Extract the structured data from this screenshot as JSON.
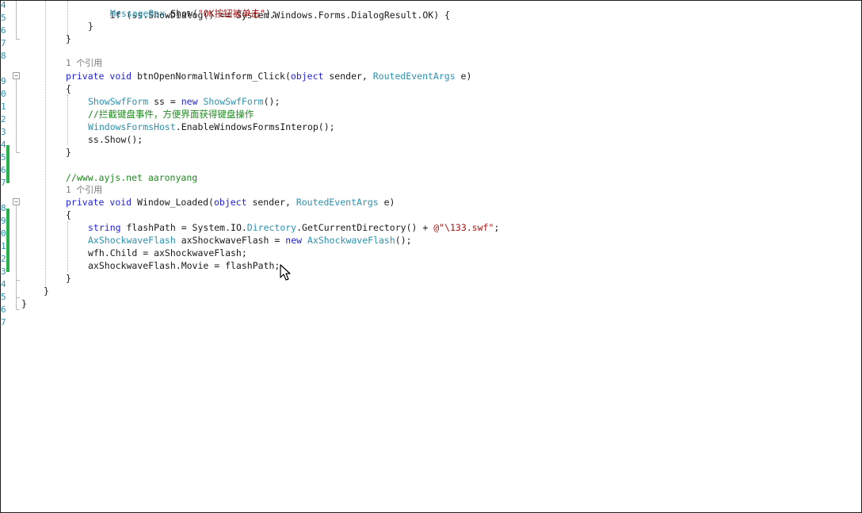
{
  "editor": {
    "line_numbers": [
      "4",
      "5",
      "6",
      "7",
      "8",
      "",
      "9",
      "0",
      "1",
      "2",
      "3",
      "4",
      "5",
      "6",
      "7",
      "",
      "8",
      "9",
      "0",
      "1",
      "2",
      "3",
      "4",
      "5",
      "6",
      "7"
    ],
    "lines": {
      "l1_pre": "if (ss.ShowDialog() == System.Windows.Forms.DialogResult.OK) {",
      "l2_type": "MessageBox",
      "l2_mid": ".Show(",
      "l2_str": "\"OK按钮被单击\"",
      "l2_end": ");",
      "l3": "}",
      "l4": "}",
      "ref1": "1 个引用",
      "m1_kw1": "private",
      "m1_kw2": "void",
      "m1_name": " btnOpenNormallWinform_Click(",
      "m1_kw3": "object",
      "m1_p1": " sender, ",
      "m1_type": "RoutedEventArgs",
      "m1_p2": " e)",
      "m1_open": "{",
      "b1_type": "ShowSwfForm",
      "b1_mid": " ss = ",
      "b1_kw": "new",
      "b1_type2": "ShowSwfForm",
      "b1_end": "();",
      "b2_comment": "//拦截键盘事件，方便界面获得键盘操作",
      "b3_type": "WindowsFormsHost",
      "b3_rest": ".EnableWindowsFormsInterop();",
      "b4": "ss.Show();",
      "m1_close": "}",
      "comment2": "//www.ayjs.net aaronyang",
      "ref2": "1 个引用",
      "m2_kw1": "private",
      "m2_kw2": "void",
      "m2_name": " Window_Loaded(",
      "m2_kw3": "object",
      "m2_p1": " sender, ",
      "m2_type": "RoutedEventArgs",
      "m2_p2": " e)",
      "m2_open": "{",
      "c1_kw": "string",
      "c1_mid": " flashPath = System.IO.",
      "c1_type": "Directory",
      "c1_mid2": ".GetCurrentDirectory() + ",
      "c1_str": "@\"\\133.swf\"",
      "c1_end": ";",
      "c2_type": "AxShockwaveFlash",
      "c2_mid": " axShockwaveFlash = ",
      "c2_kw": "new",
      "c2_type2": "AxShockwaveFlash",
      "c2_end": "();",
      "c3": "wfh.Child = axShockwaveFlash;",
      "c4": "axShockwaveFlash.Movie = flashPath;",
      "m2_close": "}",
      "class_close": "}",
      "ns_close": "}"
    }
  },
  "colors": {
    "keyword": "#1f1fd1",
    "type": "#2b91af",
    "string": "#a31515",
    "comment": "#1e8a1e",
    "change_bar": "#29b24b"
  },
  "icons": [
    "collapse-icon",
    "mouse-pointer-icon"
  ]
}
